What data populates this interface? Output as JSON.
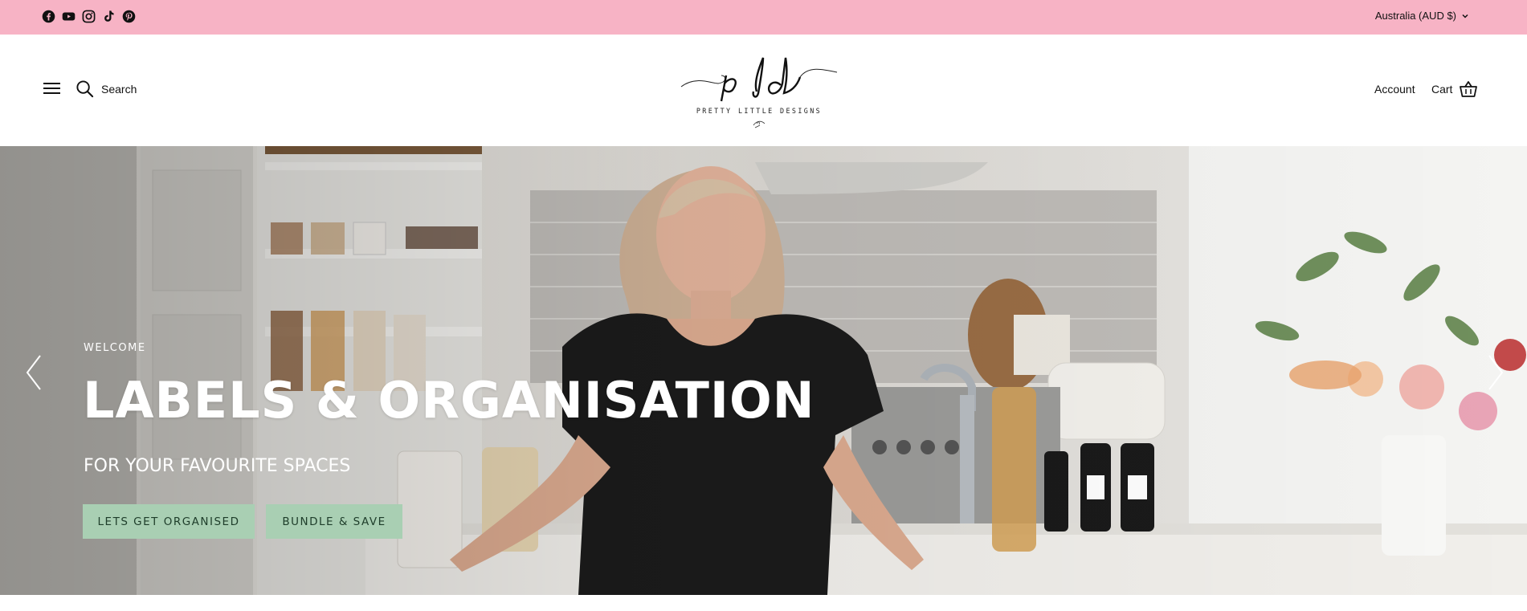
{
  "announcement": {
    "social_icons": [
      "facebook-icon",
      "youtube-icon",
      "instagram-icon",
      "tiktok-icon",
      "pinterest-icon"
    ],
    "currency_selector": "Australia (AUD $)",
    "background": "#f7b3c5"
  },
  "header": {
    "search_label": "Search",
    "logo_monogram": "pld",
    "logo_wordmark": "PRETTY LITTLE DESIGNS",
    "account_label": "Account",
    "cart_label": "Cart"
  },
  "hero": {
    "subheading": "WELCOME",
    "heading": "LABELS & ORGANISATION",
    "tagline": "FOR YOUR FAVOURITE SPACES",
    "buttons": [
      {
        "label": "LETS GET ORGANISED"
      },
      {
        "label": "BUNDLE & SAVE"
      }
    ],
    "button_color": "#a9cfb3",
    "image_description": "woman in black dress leaning on white kitchen counter with pantry jars, soap bottles and flowers"
  }
}
